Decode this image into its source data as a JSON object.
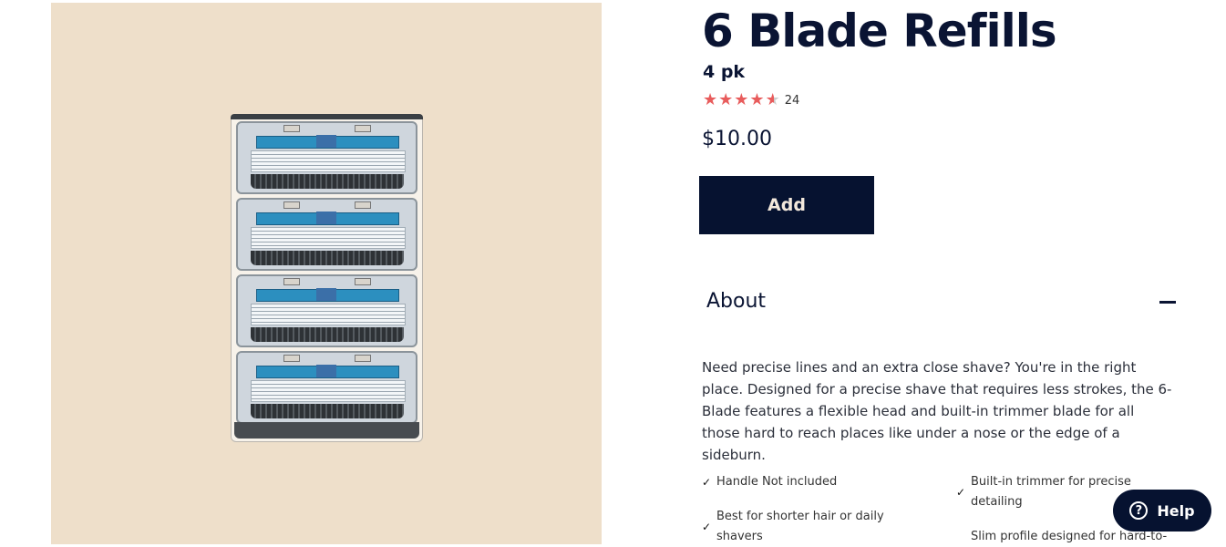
{
  "product": {
    "title": "6 Blade Refills",
    "subtitle": "4 pk",
    "rating": {
      "stars": 4.5,
      "count": "24"
    },
    "price": "$10.00",
    "add_label": "Add",
    "image_colors": {
      "background": "#eedfca",
      "accent": "#2c8fbf"
    }
  },
  "about": {
    "title": "About",
    "description": "Need precise lines and an extra close shave? You're in the right place. Designed for a precise shave that requires less strokes, the 6-Blade features a flexible head and built-in trimmer blade for all those hard to reach places like under a nose or the edge of a sideburn.",
    "features": [
      "Handle Not included",
      "Built-in trimmer for precise detailing",
      "Best for shorter hair or daily shavers",
      "Slim profile designed for hard-to-"
    ]
  },
  "help": {
    "label": "Help",
    "icon": "question-circle-icon"
  },
  "icons": {
    "star": "★",
    "check": "✓",
    "collapse": "minus-icon"
  }
}
